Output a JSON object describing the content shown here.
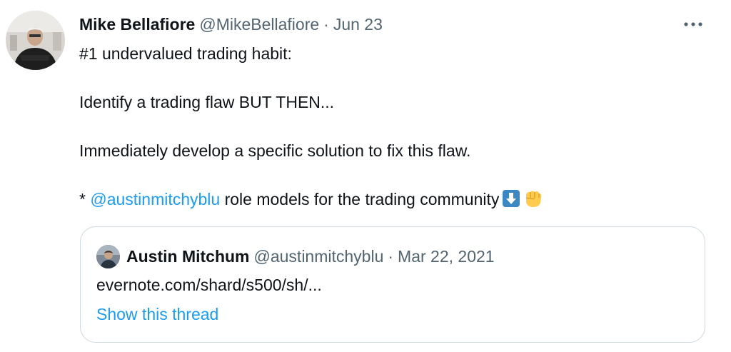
{
  "tweet": {
    "author_name": "Mike Bellafiore",
    "author_handle": "@MikeBellafiore",
    "separator": "·",
    "date": "Jun 23",
    "more_icon": "more-dots-icon",
    "lines": {
      "line1": "#1 undervalued trading habit:",
      "line2": "Identify a trading flaw BUT THEN...",
      "line3": "Immediately develop a specific solution to fix this flaw.",
      "line4_prefix": "* ",
      "line4_mention": "@austinmitchyblu",
      "line4_suffix": " role models for the trading community"
    },
    "emojis": [
      "down-arrow-emoji-icon",
      "fist-emoji-icon"
    ]
  },
  "quote": {
    "author_name": "Austin Mitchum",
    "author_handle": "@austinmitchyblu",
    "separator": "·",
    "date": "Mar 22, 2021",
    "link_text": "evernote.com/shard/s500/sh/...",
    "show_thread": "Show this thread"
  },
  "colors": {
    "text": "#0f1419",
    "secondary": "#536471",
    "accent": "#1d9bf0",
    "border": "#cfd9de"
  }
}
